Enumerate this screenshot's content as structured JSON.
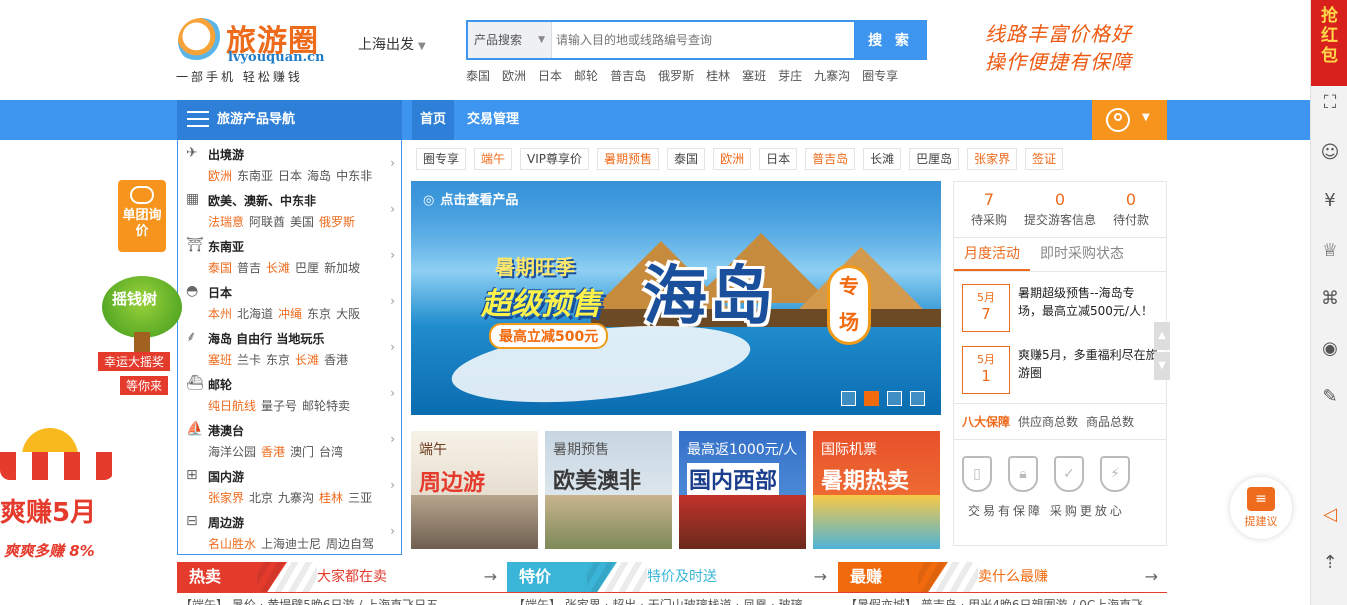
{
  "logo": {
    "name": "旅游圈",
    "url": "lvyouquan.cn",
    "slogan": "一部手机 轻松赚钱"
  },
  "city": {
    "label": "上海出发"
  },
  "search": {
    "type": "产品搜索",
    "placeholder": "请输入目的地或线路编号查询",
    "button": "搜 索"
  },
  "hot_keywords": [
    "泰国",
    "欧洲",
    "日本",
    "邮轮",
    "普吉岛",
    "俄罗斯",
    "桂林",
    "塞班",
    "芽庄",
    "九寨沟",
    "圈专享"
  ],
  "header_slogan": {
    "line1": "线路丰富价格好",
    "line2": "操作便捷有保障"
  },
  "nav": {
    "category_title": "旅游产品导航",
    "links": [
      "首页",
      "交易管理"
    ]
  },
  "categories": [
    {
      "icon": "plane-icon",
      "glyph": "✈",
      "title": "出境游",
      "subs": [
        {
          "t": "欧洲",
          "hl": true
        },
        {
          "t": "东南亚"
        },
        {
          "t": "日本"
        },
        {
          "t": "海岛"
        },
        {
          "t": "中东非"
        }
      ]
    },
    {
      "icon": "building-icon",
      "glyph": "▦",
      "title": "欧美、澳新、中东非",
      "subs": [
        {
          "t": "法瑞意",
          "hl": true
        },
        {
          "t": "阿联酋"
        },
        {
          "t": "美国"
        },
        {
          "t": "俄罗斯",
          "hl": true
        }
      ]
    },
    {
      "icon": "temple-icon",
      "glyph": "⛩",
      "title": "东南亚",
      "subs": [
        {
          "t": "泰国",
          "hl": true
        },
        {
          "t": "普吉"
        },
        {
          "t": "长滩",
          "hl": true
        },
        {
          "t": "巴厘"
        },
        {
          "t": "新加坡"
        }
      ]
    },
    {
      "icon": "fan-icon",
      "glyph": "◓",
      "title": "日本",
      "subs": [
        {
          "t": "本州",
          "hl": true
        },
        {
          "t": "北海道"
        },
        {
          "t": "冲绳",
          "hl": true
        },
        {
          "t": "东京"
        },
        {
          "t": "大阪"
        }
      ]
    },
    {
      "icon": "palm-icon",
      "glyph": "⸙",
      "title": "海岛 自由行 当地玩乐",
      "subs": [
        {
          "t": "塞班",
          "hl": true
        },
        {
          "t": "兰卡"
        },
        {
          "t": "东京"
        },
        {
          "t": "长滩",
          "hl": true
        },
        {
          "t": "香港"
        }
      ]
    },
    {
      "icon": "ship-icon",
      "glyph": "⛴",
      "title": "邮轮",
      "subs": [
        {
          "t": "纯日航线",
          "hl": true
        },
        {
          "t": "量子号"
        },
        {
          "t": "邮轮特卖"
        }
      ]
    },
    {
      "icon": "ferry-icon",
      "glyph": "⛵",
      "title": "港澳台",
      "subs": [
        {
          "t": "海洋公园"
        },
        {
          "t": "香港",
          "hl": true
        },
        {
          "t": "澳门"
        },
        {
          "t": "台湾"
        }
      ]
    },
    {
      "icon": "train-icon",
      "glyph": "⊞",
      "title": "国内游",
      "subs": [
        {
          "t": "张家界",
          "hl": true
        },
        {
          "t": "北京"
        },
        {
          "t": "九寨沟"
        },
        {
          "t": "桂林",
          "hl": true
        },
        {
          "t": "三亚"
        }
      ]
    },
    {
      "icon": "bus-icon",
      "glyph": "⊟",
      "title": "周边游",
      "subs": [
        {
          "t": "名山胜水",
          "hl": true
        },
        {
          "t": "上海迪士尼"
        },
        {
          "t": "周边自驾"
        }
      ]
    }
  ],
  "tags": [
    {
      "t": "圈专享"
    },
    {
      "t": "端午",
      "hl": true
    },
    {
      "t": "VIP尊享价"
    },
    {
      "t": "暑期预售",
      "hl": true
    },
    {
      "t": "泰国"
    },
    {
      "t": "欧洲",
      "hl": true
    },
    {
      "t": "日本"
    },
    {
      "t": "普吉岛",
      "hl": true
    },
    {
      "t": "长滩"
    },
    {
      "t": "巴厘岛"
    },
    {
      "t": "张家界",
      "hl": true
    },
    {
      "t": "签证",
      "hl": true
    }
  ],
  "banner": {
    "link": "点击查看产品",
    "line1": "暑期旺季",
    "line2": "超级预售",
    "line3": "最高立减500元",
    "title": "海岛",
    "badge": "专场",
    "active_slide": 2
  },
  "stats": [
    {
      "num": "7",
      "label": "待采购"
    },
    {
      "num": "0",
      "label": "提交游客信息"
    },
    {
      "num": "0",
      "label": "待付款"
    }
  ],
  "activity_tabs": [
    "月度活动",
    "即时采购状态"
  ],
  "news": [
    {
      "month": "5月",
      "day": "7",
      "text": "暑期超级预售--海岛专场，最高立减500元/人！"
    },
    {
      "month": "5月",
      "day": "1",
      "text": "爽赚5月，多重福利尽在旅游圈"
    }
  ],
  "guarantee_tabs": [
    "八大保障",
    "供应商总数",
    "商品总数"
  ],
  "guarantee_text": "交易有保障 采购更放心",
  "sub_banners": [
    {
      "t1": "端午",
      "t2": "周边游"
    },
    {
      "t1": "暑期预售",
      "t2": "欧美澳非"
    },
    {
      "t1": "最高返1000元/人",
      "t2": "国内西部"
    },
    {
      "t1": "国际机票",
      "t2": "暑期热卖"
    }
  ],
  "promo_bars": [
    {
      "label": "热卖",
      "caption": "大家都在卖",
      "color": "#e53b2d"
    },
    {
      "label": "特价",
      "caption": "特价及时送",
      "color": "#3ab5d8"
    },
    {
      "label": "最赚",
      "caption": "卖什么最赚",
      "color": "#f26a0e"
    }
  ],
  "tickers": [
    "【端午】 暑价 · 黄堤壁5晚6日游 / 上海直飞日五 ...",
    "【端午】 张家界 · 超出 · 天门山玻璃栈道 · 凤凰 · 玻璃 ...",
    "【暑假亦城】 普吉岛 · 甲米4晚6日親圍游 / 0C上海直飞 ..."
  ],
  "left_float": {
    "inquiry": "单团询价",
    "tree": "摇钱树",
    "ribbon1": "幸运大摇奖",
    "ribbon2": "等你来",
    "awning_big": "爽赚5月",
    "awning_small": "爽爽多赚 8%"
  },
  "redpack": "抢红包",
  "suggest": "提建议",
  "toolbar_icons": [
    "qr-icon",
    "service-icon",
    "currency-icon",
    "crown-icon",
    "apps-icon",
    "eye-icon",
    "edit-icon",
    "speaker-icon",
    "top-icon"
  ]
}
